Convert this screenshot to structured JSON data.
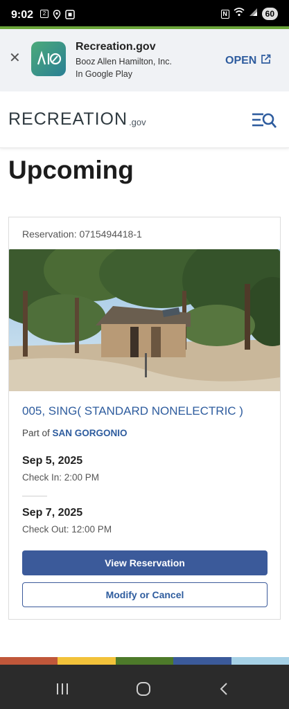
{
  "status_bar": {
    "time": "9:02",
    "notification_badge": "2",
    "battery": "60"
  },
  "app_banner": {
    "app_name": "Recreation.gov",
    "developer": "Booz Allen Hamilton, Inc.",
    "store": "In Google Play",
    "open_label": "OPEN"
  },
  "header": {
    "logo_word": "RECREATION",
    "logo_tld": ".gov"
  },
  "page": {
    "title": "Upcoming"
  },
  "reservation": {
    "number_label": "Reservation: 0715494418-1",
    "site_name": "005, SING( STANDARD NONELECTRIC )",
    "part_of_prefix": "Part of",
    "part_of_link": "SAN GORGONIO",
    "checkin_date": "Sep 5, 2025",
    "checkin_time": "Check In: 2:00 PM",
    "checkout_date": "Sep 7, 2025",
    "checkout_time": "Check Out: 12:00 PM",
    "view_button": "View Reservation",
    "modify_button": "Modify or Cancel"
  },
  "footer_stripe_colors": [
    "#c0573a",
    "#f2c23a",
    "#4d7a2a",
    "#3b5a9a",
    "#a6d1e6"
  ],
  "colors": {
    "brand_blue": "#2e5c9e",
    "button_blue": "#3b5a9a"
  }
}
